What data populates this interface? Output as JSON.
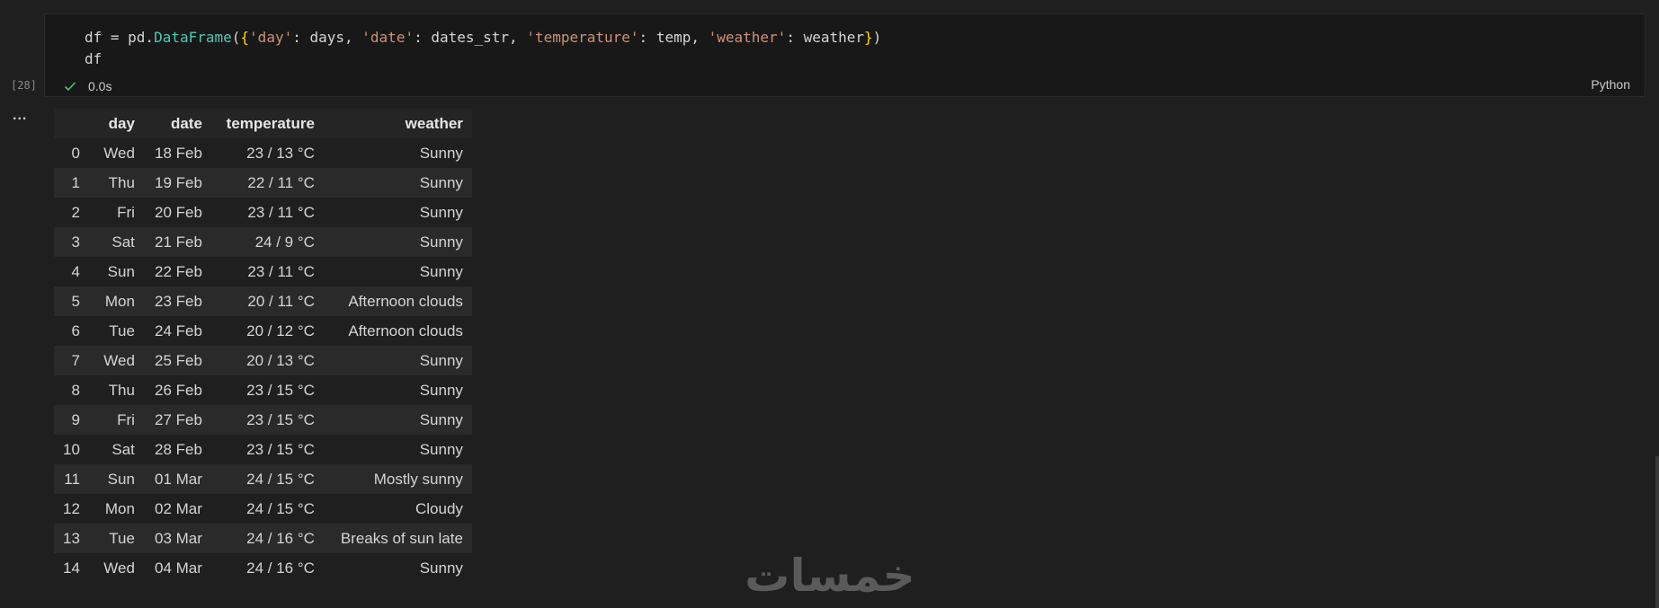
{
  "cell": {
    "execution_count": "[28]",
    "code_line1": {
      "p1": "df = pd.",
      "fn": "DataFrame",
      "p2": "(",
      "br_open": "{",
      "k1": "'day'",
      "v1": ": days, ",
      "k2": "'date'",
      "v2": ": dates_str, ",
      "k3": "'temperature'",
      "v3": ": temp, ",
      "k4": "'weather'",
      "v4": ": weather",
      "br_close": "}",
      "p3": ")"
    },
    "code_line2": "df",
    "exec_time": "0.0s",
    "language": "Python"
  },
  "output": {
    "ellipsis": "...",
    "table": {
      "columns": [
        "day",
        "date",
        "temperature",
        "weather"
      ],
      "rows": [
        {
          "index": "0",
          "day": "Wed",
          "date": "18 Feb",
          "temperature": "23 / 13 °C",
          "weather": "Sunny"
        },
        {
          "index": "1",
          "day": "Thu",
          "date": "19 Feb",
          "temperature": "22 / 11 °C",
          "weather": "Sunny"
        },
        {
          "index": "2",
          "day": "Fri",
          "date": "20 Feb",
          "temperature": "23 / 11 °C",
          "weather": "Sunny"
        },
        {
          "index": "3",
          "day": "Sat",
          "date": "21 Feb",
          "temperature": "24 / 9 °C",
          "weather": "Sunny"
        },
        {
          "index": "4",
          "day": "Sun",
          "date": "22 Feb",
          "temperature": "23 / 11 °C",
          "weather": "Sunny"
        },
        {
          "index": "5",
          "day": "Mon",
          "date": "23 Feb",
          "temperature": "20 / 11 °C",
          "weather": "Afternoon clouds"
        },
        {
          "index": "6",
          "day": "Tue",
          "date": "24 Feb",
          "temperature": "20 / 12 °C",
          "weather": "Afternoon clouds"
        },
        {
          "index": "7",
          "day": "Wed",
          "date": "25 Feb",
          "temperature": "20 / 13 °C",
          "weather": "Sunny"
        },
        {
          "index": "8",
          "day": "Thu",
          "date": "26 Feb",
          "temperature": "23 / 15 °C",
          "weather": "Sunny"
        },
        {
          "index": "9",
          "day": "Fri",
          "date": "27 Feb",
          "temperature": "23 / 15 °C",
          "weather": "Sunny"
        },
        {
          "index": "10",
          "day": "Sat",
          "date": "28 Feb",
          "temperature": "23 / 15 °C",
          "weather": "Sunny"
        },
        {
          "index": "11",
          "day": "Sun",
          "date": "01 Mar",
          "temperature": "24 / 15 °C",
          "weather": "Mostly sunny"
        },
        {
          "index": "12",
          "day": "Mon",
          "date": "02 Mar",
          "temperature": "24 / 15 °C",
          "weather": "Cloudy"
        },
        {
          "index": "13",
          "day": "Tue",
          "date": "03 Mar",
          "temperature": "24 / 16 °C",
          "weather": "Breaks of sun late"
        },
        {
          "index": "14",
          "day": "Wed",
          "date": "04 Mar",
          "temperature": "24 / 16 °C",
          "weather": "Sunny"
        }
      ]
    }
  },
  "watermark": {
    "text": "خمسات",
    "color": "#5a5a5a"
  },
  "icons": {
    "success": "check-icon"
  },
  "colors": {
    "success_check": "#4ec07a",
    "code_function": "#4ec9b0",
    "code_string": "#ce9178",
    "code_brace": "#ffd700"
  }
}
